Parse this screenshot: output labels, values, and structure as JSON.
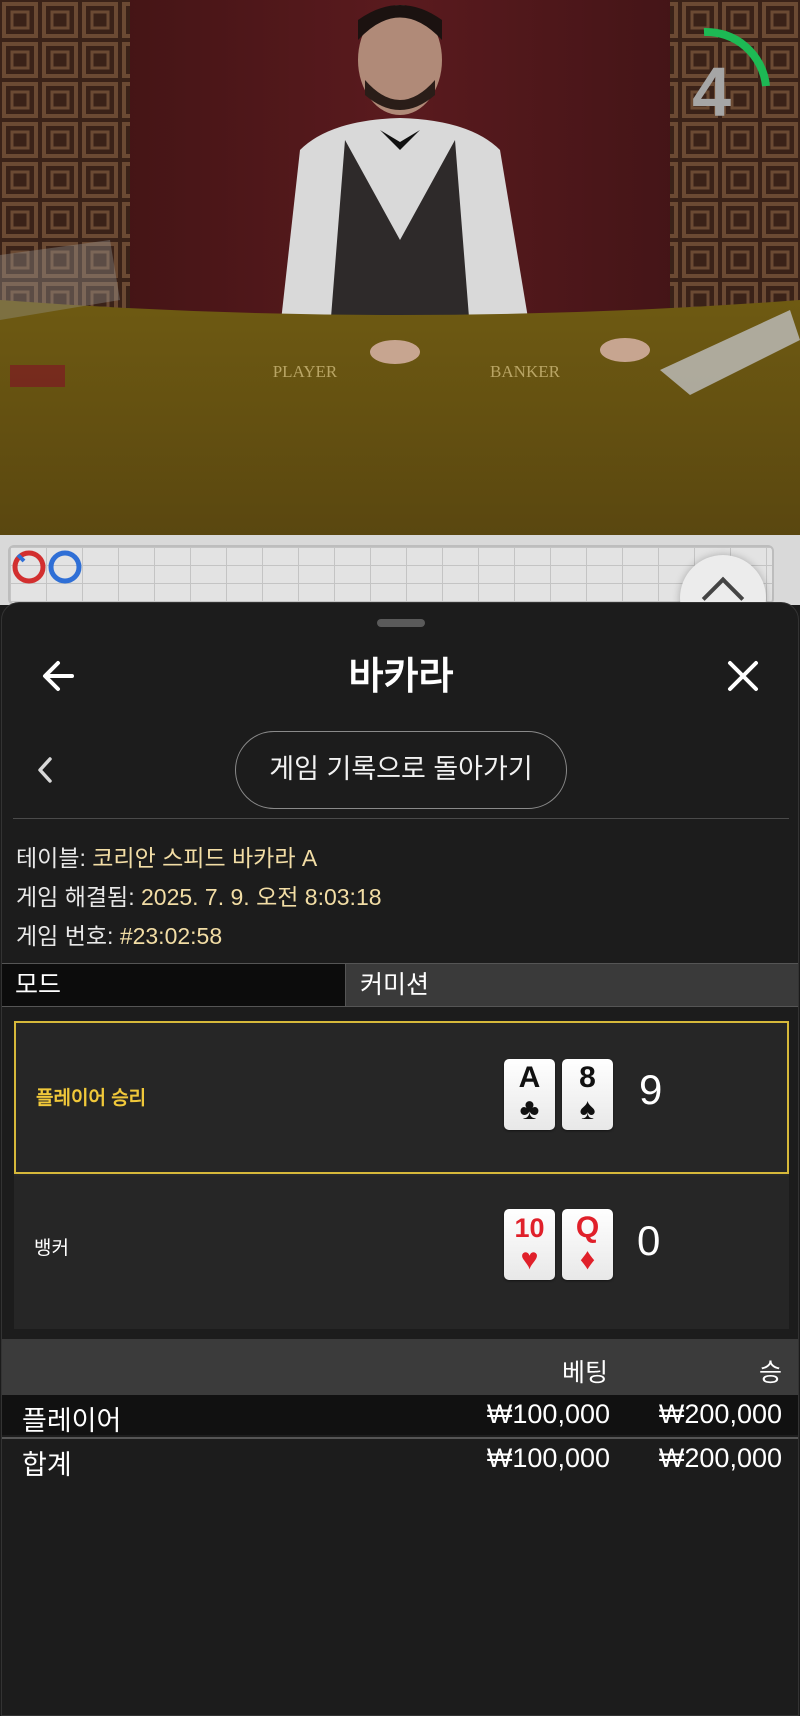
{
  "video": {
    "table_markings": {
      "player": "PLAYER",
      "banker": "BANKER"
    },
    "countdown": "4"
  },
  "sheet": {
    "title": "바카라",
    "return_button": "게임 기록으로 돌아가기",
    "info": {
      "table_label": "테이블: ",
      "table_value": "코리안 스피드 바카라 A",
      "resolved_label": "게임 해결됨: ",
      "resolved_value": "2025. 7. 9. 오전 8:03:18",
      "game_no_label": "게임 번호: ",
      "game_no_value": "#23:02:58"
    },
    "mode_label": "모드",
    "commission_label": "커미션",
    "results": {
      "player": {
        "label": "플레이어 승리",
        "cards": [
          {
            "rank": "A",
            "suit": "♣"
          },
          {
            "rank": "8",
            "suit": "♠"
          }
        ],
        "score": "9"
      },
      "banker": {
        "label": "뱅커",
        "cards": [
          {
            "rank": "10",
            "suit": "♥"
          },
          {
            "rank": "Q",
            "suit": "♦"
          }
        ],
        "score": "0"
      }
    },
    "bets": {
      "headers": {
        "bet": "베팅",
        "win": "승"
      },
      "rows": [
        {
          "name": "플레이어",
          "bet": "₩100,000",
          "win": "₩200,000"
        }
      ],
      "total": {
        "name": "합계",
        "bet": "₩100,000",
        "win": "₩200,000"
      }
    }
  },
  "colors": {
    "win_highlight": "#d6b83a",
    "info_value": "#f2dda5",
    "timer_arc": "#1db954",
    "card_red": "#e0202a"
  },
  "icons": [
    "back-arrow-icon",
    "close-icon",
    "chevron-left-icon",
    "chevron-up-icon",
    "roadmap-circle-icon"
  ]
}
